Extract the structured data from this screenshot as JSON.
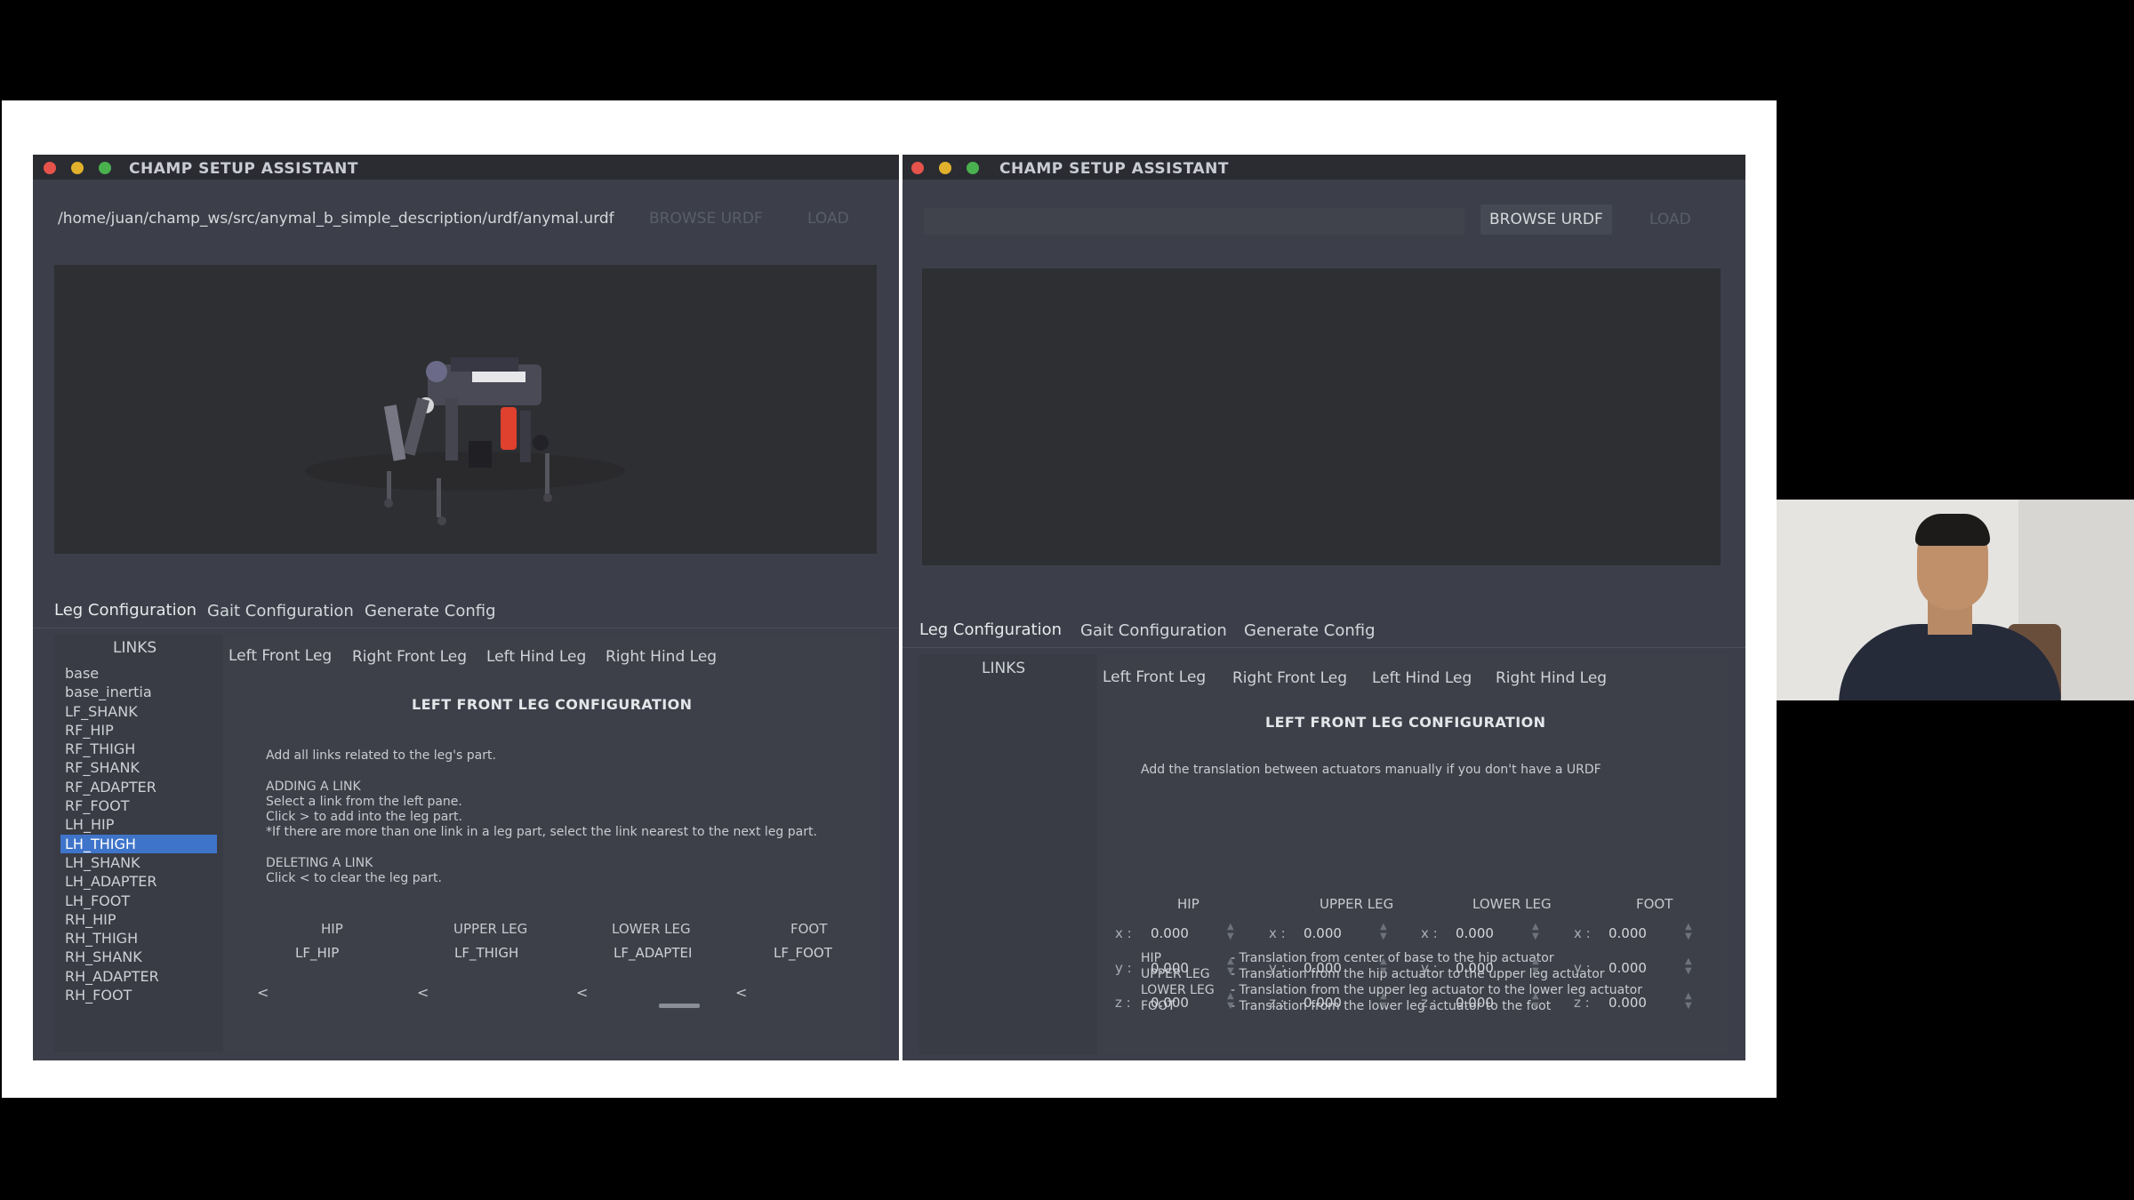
{
  "left": {
    "title": "CHAMP SETUP ASSISTANT",
    "urdf_path": "/home/juan/champ_ws/src/anymal_b_simple_description/urdf/anymal.urdf",
    "browse_label": "BROWSE URDF",
    "load_label": "LOAD",
    "tabs": [
      "Leg Configuration",
      "Gait Configuration",
      "Generate Config"
    ],
    "links_title": "LINKS",
    "links": [
      "base",
      "base_inertia",
      "LF_SHANK",
      "RF_HIP",
      "RF_THIGH",
      "RF_SHANK",
      "RF_ADAPTER",
      "RF_FOOT",
      "LH_HIP",
      "LH_THIGH",
      "LH_SHANK",
      "LH_ADAPTER",
      "LH_FOOT",
      "RH_HIP",
      "RH_THIGH",
      "RH_SHANK",
      "RH_ADAPTER",
      "RH_FOOT"
    ],
    "selected_link": "LH_THIGH",
    "leg_tabs": [
      "Left Front Leg",
      "Right Front Leg",
      "Left Hind Leg",
      "Right Hind Leg"
    ],
    "heading": "LEFT FRONT LEG CONFIGURATION",
    "intro": "Add all links related to the leg's part.",
    "adding_title": "ADDING A LINK",
    "adding_lines": [
      "Select a link from the left pane.",
      "Click > to add into the leg part.",
      "*If there are more than one link in a leg part, select the link nearest to the next leg part."
    ],
    "deleting_title": "DELETING A LINK",
    "deleting_line": "Click < to clear the leg part.",
    "parts": [
      {
        "header": "HIP",
        "value": "LF_HIP"
      },
      {
        "header": "UPPER LEG",
        "value": "LF_THIGH"
      },
      {
        "header": "LOWER LEG",
        "value": "LF_ADAPTEI"
      },
      {
        "header": "FOOT",
        "value": "LF_FOOT"
      }
    ],
    "arrow": "<"
  },
  "right": {
    "title": "CHAMP SETUP ASSISTANT",
    "browse_label": "BROWSE URDF",
    "load_label": "LOAD",
    "tabs": [
      "Leg Configuration",
      "Gait Configuration",
      "Generate Config"
    ],
    "links_title": "LINKS",
    "leg_tabs": [
      "Left Front Leg",
      "Right Front Leg",
      "Left Hind Leg",
      "Right Hind Leg"
    ],
    "heading": "LEFT FRONT LEG CONFIGURATION",
    "intro": "Add the translation between actuators manually if you don't have a URDF",
    "definitions": [
      {
        "term": "HIP",
        "desc": "- Translation from center of base to the hip actuator"
      },
      {
        "term": "UPPER LEG",
        "desc": "- Translation from the hip actuator to the upper leg actuator"
      },
      {
        "term": "LOWER LEG",
        "desc": "- Translation from the upper leg actuator to the lower leg actuator"
      },
      {
        "term": "FOOT",
        "desc": "- Translation from the lower leg actuator to the foot"
      }
    ],
    "columns": [
      "HIP",
      "UPPER LEG",
      "LOWER LEG",
      "FOOT"
    ],
    "axes": [
      "x :",
      "y :",
      "z :"
    ],
    "values": [
      [
        "0.000",
        "0.000",
        "0.000",
        "0.000"
      ],
      [
        "0.000",
        "0.000",
        "0.000",
        "0.000"
      ],
      [
        "0.000",
        "0.000",
        "0.000",
        "0.000"
      ]
    ]
  },
  "colors": {
    "window_bg": "#3c3f49",
    "titlebar": "#2a2c31",
    "viewport": "#2e2f33",
    "selection": "#3e74c9",
    "close": "#e5534b",
    "minimize": "#e1b12c",
    "maximize": "#49b14e"
  }
}
